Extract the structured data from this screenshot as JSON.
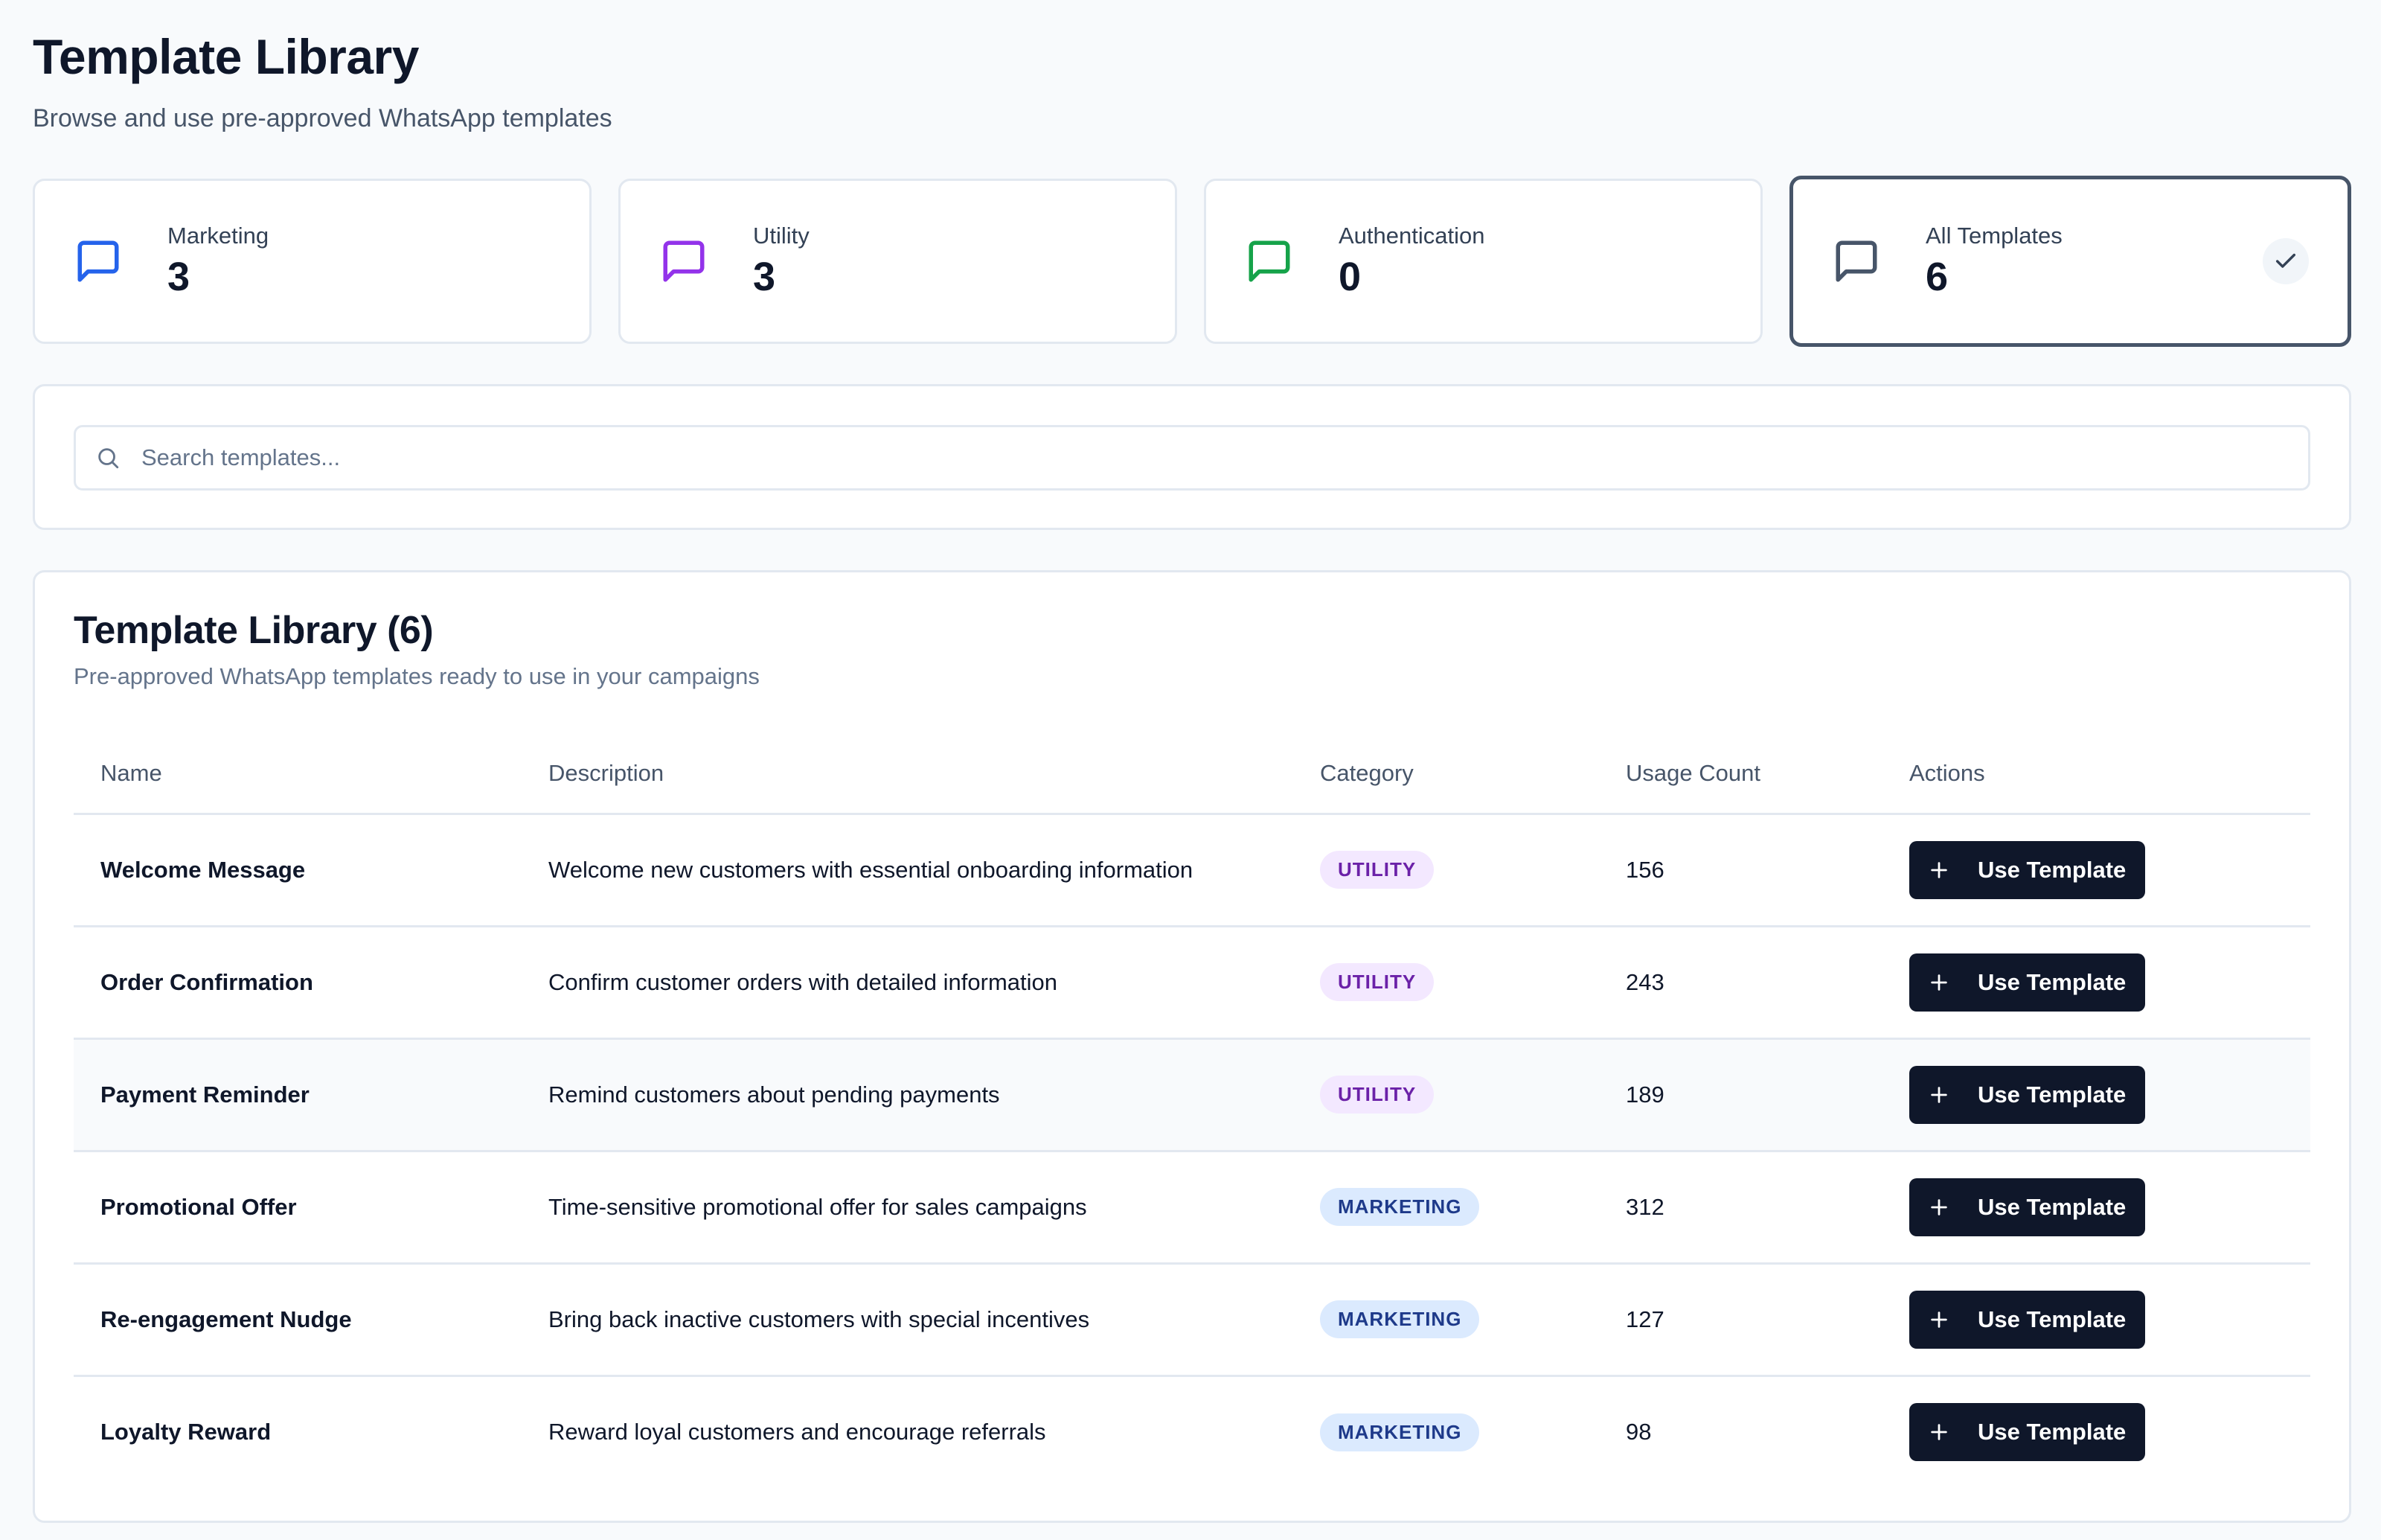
{
  "header": {
    "title": "Template Library",
    "subtitle": "Browse and use pre-approved WhatsApp templates"
  },
  "stats": [
    {
      "label": "Marketing",
      "value": "3",
      "icon": "message-square-icon",
      "color": "#2563eb"
    },
    {
      "label": "Utility",
      "value": "3",
      "icon": "message-square-icon",
      "color": "#9333ea"
    },
    {
      "label": "Authentication",
      "value": "0",
      "icon": "message-square-icon",
      "color": "#16a34a"
    },
    {
      "label": "All Templates",
      "value": "6",
      "icon": "message-square-icon",
      "color": "#475569",
      "selected": true
    }
  ],
  "search": {
    "placeholder": "Search templates..."
  },
  "library": {
    "title": "Template Library (6)",
    "subtitle": "Pre-approved WhatsApp templates ready to use in your campaigns",
    "columns": [
      "Name",
      "Description",
      "Category",
      "Usage Count",
      "Actions"
    ],
    "rows": [
      {
        "name": "Welcome Message",
        "description": "Welcome new customers with essential onboarding information",
        "category": "UTILITY",
        "usage": "156",
        "action": "Use Template"
      },
      {
        "name": "Order Confirmation",
        "description": "Confirm customer orders with detailed information",
        "category": "UTILITY",
        "usage": "243",
        "action": "Use Template"
      },
      {
        "name": "Payment Reminder",
        "description": "Remind customers about pending payments",
        "category": "UTILITY",
        "usage": "189",
        "action": "Use Template"
      },
      {
        "name": "Promotional Offer",
        "description": "Time-sensitive promotional offer for sales campaigns",
        "category": "MARKETING",
        "usage": "312",
        "action": "Use Template"
      },
      {
        "name": "Re-engagement Nudge",
        "description": "Bring back inactive customers with special incentives",
        "category": "MARKETING",
        "usage": "127",
        "action": "Use Template"
      },
      {
        "name": "Loyalty Reward",
        "description": "Reward loyal customers and encourage referrals",
        "category": "MARKETING",
        "usage": "98",
        "action": "Use Template"
      }
    ]
  }
}
